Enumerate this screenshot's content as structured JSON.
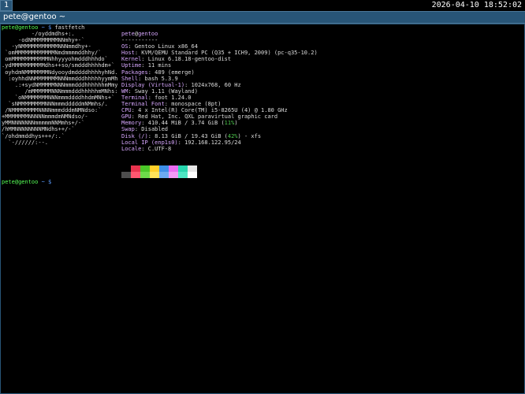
{
  "bar": {
    "workspace": "1",
    "clock": "2026-04-10 18:52:02"
  },
  "window": {
    "title": "pete@gentoo ~"
  },
  "prompt": {
    "user": "pete@gentoo",
    "path": "~",
    "symbol": "$",
    "command": "fastfetch"
  },
  "logo_lines": [
    "         -/oyddmdhs+:.",
    "     -odNMMMMMMMMNNmhy+-`",
    "   -yNMMMMMMMMMMMNNNmmdhy+-",
    " `omMMMMMMMMMMMMNmdmmmmddhhy/`",
    " omMMMMMMMMMMMNhhyyyohmdddhhhdo`",
    ".ydMMMMMMMMMMdhs++so/smdddhhhhdm+`",
    " oyhdmNMMMMMMMNdyooydmddddhhhhyhNd.",
    "  :oyhhdNNMMMMMMMNNNmmdddhhhhhyymMh",
    "    .:+sydNMMMMMNNNmmmdddhhhhhhmMmy",
    "       /mMMMMMMNNNmmmdddhhhhhmMNhs:",
    "    `oNMMMMMMMNNNmmmddddhhdmMNhs+`",
    "  `sNMMMMMMMMNNNmmmdddddmNMmhs/.",
    " /NMMMMMMMMNNNNmmmdddmNMNdso:`",
    "+MMMMMMMNNNNNmmmdmNMNdso/-",
    "yMMNNNNNNNmmmmmNNMmhs+/-`",
    "/hMMNNNNNNNNMNdhs++/-`",
    "`/ohdmmddhys+++/:.`",
    "  `-//////:--."
  ],
  "info": {
    "title_user": "pete",
    "title_host": "gentoo",
    "separator": "-----------",
    "rows": [
      {
        "key": "OS",
        "value": "Gentoo Linux x86_64"
      },
      {
        "key": "Host",
        "value": "KVM/QEMU Standard PC (Q35 + ICH9, 2009) (pc-q35-10.2)"
      },
      {
        "key": "Kernel",
        "value": "Linux 6.18.18-gentoo-dist"
      },
      {
        "key": "Uptime",
        "value": "11 mins"
      },
      {
        "key": "Packages",
        "value": "489 (emerge)"
      },
      {
        "key": "Shell",
        "value": "bash 5.3.9"
      },
      {
        "key": "Display (Virtual-1)",
        "value": "1024x768, 60 Hz"
      },
      {
        "key": "WM",
        "value": "Sway 1.11 (Wayland)"
      },
      {
        "key": "Terminal",
        "value": "foot 1.24.0"
      },
      {
        "key": "Terminal Font",
        "value": "monospace (8pt)"
      },
      {
        "key": "CPU",
        "value": "4 x Intel(R) Core(TM) i5-8265U (4) @ 1.80 GHz"
      },
      {
        "key": "GPU",
        "value": "Red Hat, Inc. QXL paravirtual graphic card"
      }
    ],
    "memory": {
      "key": "Memory",
      "value_before": "410.44 MiB / 3.74 GiB (",
      "percent": "11%",
      "value_after": ")"
    },
    "swap": {
      "key": "Swap",
      "value": "Disabled"
    },
    "disk": {
      "key": "Disk (/)",
      "value_before": "8.13 GiB / 19.43 GiB (",
      "percent": "42%",
      "value_after": ") - xfs"
    },
    "local_ip": {
      "key": "Local IP (enp1s0)",
      "value": "192.168.122.95/24"
    },
    "locale": {
      "key": "Locale",
      "value": "C.UTF-8"
    }
  },
  "palette_top": [
    "#000000",
    "#e8344e",
    "#4bc728",
    "#ffd029",
    "#3e8fe8",
    "#e96bf1",
    "#27d6ae",
    "#e6e6e6"
  ],
  "palette_bottom": [
    "#4d4d4d",
    "#ff5770",
    "#6ed94a",
    "#ffe35a",
    "#6daaf2",
    "#f39af7",
    "#4fe7c4",
    "#ffffff"
  ],
  "prompt2": {
    "user": "pete@gentoo",
    "path": "~",
    "symbol": "$"
  }
}
